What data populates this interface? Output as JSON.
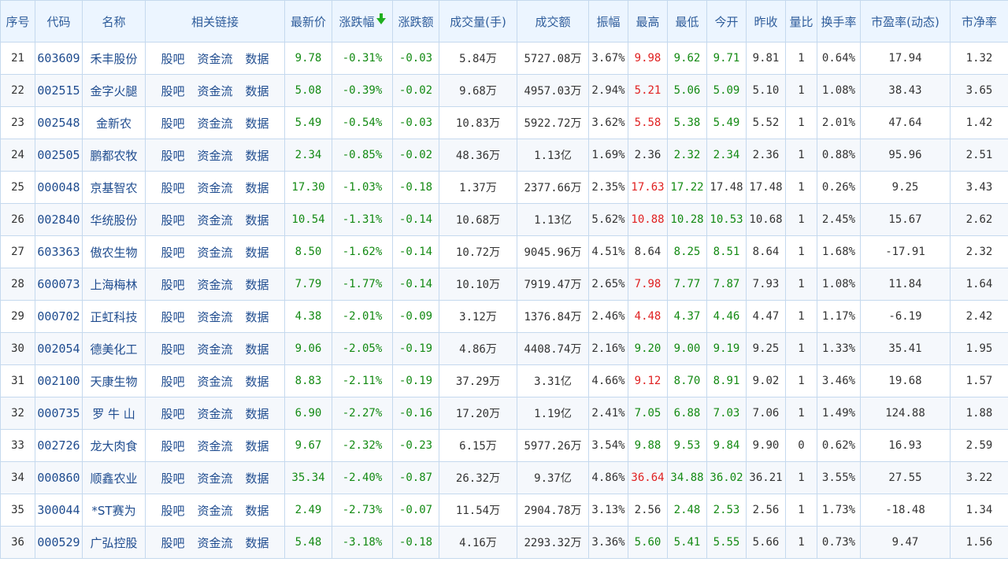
{
  "colors": {
    "up": "#e02121",
    "down": "#138a13",
    "link": "#1f4c8f",
    "header_bg": "#ecf5ff",
    "border": "#c5d9ee"
  },
  "headers": {
    "seq": "序号",
    "code": "代码",
    "name": "名称",
    "links": "相关链接",
    "price": "最新价",
    "change_pct": "涨跌幅",
    "change": "涨跌额",
    "volume": "成交量(手)",
    "amount": "成交额",
    "amplitude": "振幅",
    "high": "最高",
    "low": "最低",
    "open": "今开",
    "prev_close": "昨收",
    "vol_ratio": "量比",
    "turnover": "换手率",
    "pe": "市盈率(动态)",
    "pb": "市净率"
  },
  "sort_icon": "sort-desc-arrow-icon",
  "link_labels": {
    "guba": "股吧",
    "fund_flow": "资金流",
    "data": "数据"
  },
  "rows": [
    {
      "seq": "21",
      "code": "603609",
      "name": "禾丰股份",
      "price": "9.78",
      "change_pct": "-0.31%",
      "change": "-0.03",
      "volume": "5.84万",
      "amount": "5727.08万",
      "amplitude": "3.67%",
      "high": "9.98",
      "low": "9.62",
      "open": "9.71",
      "prev_close": "9.81",
      "vol_ratio": "1",
      "turnover": "0.64%",
      "pe": "17.94",
      "pb": "1.32"
    },
    {
      "seq": "22",
      "code": "002515",
      "name": "金字火腿",
      "price": "5.08",
      "change_pct": "-0.39%",
      "change": "-0.02",
      "volume": "9.68万",
      "amount": "4957.03万",
      "amplitude": "2.94%",
      "high": "5.21",
      "low": "5.06",
      "open": "5.09",
      "prev_close": "5.10",
      "vol_ratio": "1",
      "turnover": "1.08%",
      "pe": "38.43",
      "pb": "3.65"
    },
    {
      "seq": "23",
      "code": "002548",
      "name": "金新农",
      "price": "5.49",
      "change_pct": "-0.54%",
      "change": "-0.03",
      "volume": "10.83万",
      "amount": "5922.72万",
      "amplitude": "3.62%",
      "high": "5.58",
      "low": "5.38",
      "open": "5.49",
      "prev_close": "5.52",
      "vol_ratio": "1",
      "turnover": "2.01%",
      "pe": "47.64",
      "pb": "1.42"
    },
    {
      "seq": "24",
      "code": "002505",
      "name": "鹏都农牧",
      "price": "2.34",
      "change_pct": "-0.85%",
      "change": "-0.02",
      "volume": "48.36万",
      "amount": "1.13亿",
      "amplitude": "1.69%",
      "high": "2.36",
      "low": "2.32",
      "open": "2.34",
      "prev_close": "2.36",
      "vol_ratio": "1",
      "turnover": "0.88%",
      "pe": "95.96",
      "pb": "2.51"
    },
    {
      "seq": "25",
      "code": "000048",
      "name": "京基智农",
      "price": "17.30",
      "change_pct": "-1.03%",
      "change": "-0.18",
      "volume": "1.37万",
      "amount": "2377.66万",
      "amplitude": "2.35%",
      "high": "17.63",
      "low": "17.22",
      "open": "17.48",
      "prev_close": "17.48",
      "vol_ratio": "1",
      "turnover": "0.26%",
      "pe": "9.25",
      "pb": "3.43"
    },
    {
      "seq": "26",
      "code": "002840",
      "name": "华统股份",
      "price": "10.54",
      "change_pct": "-1.31%",
      "change": "-0.14",
      "volume": "10.68万",
      "amount": "1.13亿",
      "amplitude": "5.62%",
      "high": "10.88",
      "low": "10.28",
      "open": "10.53",
      "prev_close": "10.68",
      "vol_ratio": "1",
      "turnover": "2.45%",
      "pe": "15.67",
      "pb": "2.62"
    },
    {
      "seq": "27",
      "code": "603363",
      "name": "傲农生物",
      "price": "8.50",
      "change_pct": "-1.62%",
      "change": "-0.14",
      "volume": "10.72万",
      "amount": "9045.96万",
      "amplitude": "4.51%",
      "high": "8.64",
      "low": "8.25",
      "open": "8.51",
      "prev_close": "8.64",
      "vol_ratio": "1",
      "turnover": "1.68%",
      "pe": "-17.91",
      "pb": "2.32"
    },
    {
      "seq": "28",
      "code": "600073",
      "name": "上海梅林",
      "price": "7.79",
      "change_pct": "-1.77%",
      "change": "-0.14",
      "volume": "10.10万",
      "amount": "7919.47万",
      "amplitude": "2.65%",
      "high": "7.98",
      "low": "7.77",
      "open": "7.87",
      "prev_close": "7.93",
      "vol_ratio": "1",
      "turnover": "1.08%",
      "pe": "11.84",
      "pb": "1.64"
    },
    {
      "seq": "29",
      "code": "000702",
      "name": "正虹科技",
      "price": "4.38",
      "change_pct": "-2.01%",
      "change": "-0.09",
      "volume": "3.12万",
      "amount": "1376.84万",
      "amplitude": "2.46%",
      "high": "4.48",
      "low": "4.37",
      "open": "4.46",
      "prev_close": "4.47",
      "vol_ratio": "1",
      "turnover": "1.17%",
      "pe": "-6.19",
      "pb": "2.42"
    },
    {
      "seq": "30",
      "code": "002054",
      "name": "德美化工",
      "price": "9.06",
      "change_pct": "-2.05%",
      "change": "-0.19",
      "volume": "4.86万",
      "amount": "4408.74万",
      "amplitude": "2.16%",
      "high": "9.20",
      "low": "9.00",
      "open": "9.19",
      "prev_close": "9.25",
      "vol_ratio": "1",
      "turnover": "1.33%",
      "pe": "35.41",
      "pb": "1.95"
    },
    {
      "seq": "31",
      "code": "002100",
      "name": "天康生物",
      "price": "8.83",
      "change_pct": "-2.11%",
      "change": "-0.19",
      "volume": "37.29万",
      "amount": "3.31亿",
      "amplitude": "4.66%",
      "high": "9.12",
      "low": "8.70",
      "open": "8.91",
      "prev_close": "9.02",
      "vol_ratio": "1",
      "turnover": "3.46%",
      "pe": "19.68",
      "pb": "1.57"
    },
    {
      "seq": "32",
      "code": "000735",
      "name": "罗 牛 山",
      "price": "6.90",
      "change_pct": "-2.27%",
      "change": "-0.16",
      "volume": "17.20万",
      "amount": "1.19亿",
      "amplitude": "2.41%",
      "high": "7.05",
      "low": "6.88",
      "open": "7.03",
      "prev_close": "7.06",
      "vol_ratio": "1",
      "turnover": "1.49%",
      "pe": "124.88",
      "pb": "1.88"
    },
    {
      "seq": "33",
      "code": "002726",
      "name": "龙大肉食",
      "price": "9.67",
      "change_pct": "-2.32%",
      "change": "-0.23",
      "volume": "6.15万",
      "amount": "5977.26万",
      "amplitude": "3.54%",
      "high": "9.88",
      "low": "9.53",
      "open": "9.84",
      "prev_close": "9.90",
      "vol_ratio": "0",
      "turnover": "0.62%",
      "pe": "16.93",
      "pb": "2.59"
    },
    {
      "seq": "34",
      "code": "000860",
      "name": "顺鑫农业",
      "price": "35.34",
      "change_pct": "-2.40%",
      "change": "-0.87",
      "volume": "26.32万",
      "amount": "9.37亿",
      "amplitude": "4.86%",
      "high": "36.64",
      "low": "34.88",
      "open": "36.02",
      "prev_close": "36.21",
      "vol_ratio": "1",
      "turnover": "3.55%",
      "pe": "27.55",
      "pb": "3.22"
    },
    {
      "seq": "35",
      "code": "300044",
      "name": "*ST赛为",
      "price": "2.49",
      "change_pct": "-2.73%",
      "change": "-0.07",
      "volume": "11.54万",
      "amount": "2904.78万",
      "amplitude": "3.13%",
      "high": "2.56",
      "low": "2.48",
      "open": "2.53",
      "prev_close": "2.56",
      "vol_ratio": "1",
      "turnover": "1.73%",
      "pe": "-18.48",
      "pb": "1.34"
    },
    {
      "seq": "36",
      "code": "000529",
      "name": "广弘控股",
      "price": "5.48",
      "change_pct": "-3.18%",
      "change": "-0.18",
      "volume": "4.16万",
      "amount": "2293.32万",
      "amplitude": "3.36%",
      "high": "5.60",
      "low": "5.41",
      "open": "5.55",
      "prev_close": "5.66",
      "vol_ratio": "1",
      "turnover": "0.73%",
      "pe": "9.47",
      "pb": "1.56"
    }
  ]
}
